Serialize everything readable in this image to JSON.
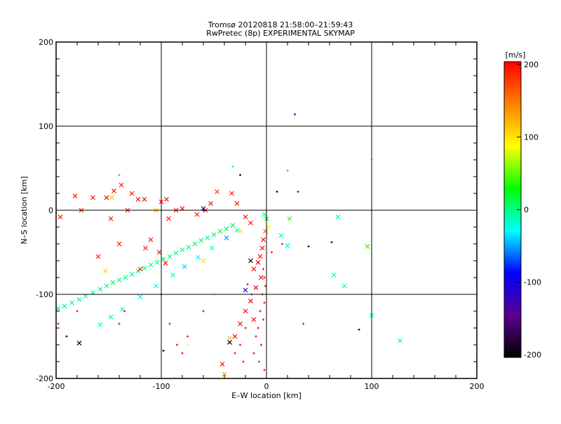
{
  "chart_data": {
    "type": "scatter",
    "title": "Tromsø 20120818 21:58:00–21:59:43",
    "subtitle": "RwPretec (8p) EXPERIMENTAL SKYMAP",
    "xlabel": "E–W location [km]",
    "ylabel": "N–S location [km]",
    "xlim": [
      -200,
      200
    ],
    "ylim": [
      -200,
      200
    ],
    "xticks": [
      "-200",
      "-100",
      "0",
      "100",
      "200"
    ],
    "yticks": [
      "-200",
      "-100",
      "0",
      "100",
      "200"
    ],
    "grid": true,
    "colorbar": {
      "label": "[m/s]",
      "range": [
        -200,
        200
      ],
      "ticks": [
        "200",
        "100",
        "0",
        "-100",
        "-200"
      ],
      "colors": [
        "#000000",
        "#5a0090",
        "#0000ff",
        "#00ffff",
        "#00ff00",
        "#ffff00",
        "#ff8000",
        "#ff0000"
      ]
    },
    "points_columns": [
      "x_km",
      "y_km",
      "velocity_ms",
      "marker"
    ],
    "points": [
      [
        -198,
        -117,
        0,
        "x"
      ],
      [
        -192,
        -114,
        -5,
        "x"
      ],
      [
        -185,
        -110,
        5,
        "x"
      ],
      [
        -178,
        -106,
        0,
        "x"
      ],
      [
        -172,
        -102,
        -10,
        "x"
      ],
      [
        -165,
        -98,
        0,
        "x"
      ],
      [
        -158,
        -94,
        -5,
        "x"
      ],
      [
        -152,
        -90,
        0,
        "x"
      ],
      [
        -146,
        -86,
        5,
        "x"
      ],
      [
        -140,
        -83,
        -5,
        "x"
      ],
      [
        -134,
        -80,
        0,
        "x"
      ],
      [
        -128,
        -76,
        -10,
        "x"
      ],
      [
        -122,
        -72,
        0,
        "x"
      ],
      [
        -116,
        -69,
        5,
        "x"
      ],
      [
        -110,
        -65,
        0,
        "x"
      ],
      [
        -104,
        -62,
        -5,
        "x"
      ],
      [
        -98,
        -58,
        0,
        "x"
      ],
      [
        -92,
        -55,
        5,
        "x"
      ],
      [
        -86,
        -51,
        0,
        "x"
      ],
      [
        -80,
        -47,
        -5,
        "x"
      ],
      [
        -74,
        -44,
        0,
        "x"
      ],
      [
        -68,
        -40,
        5,
        "x"
      ],
      [
        -62,
        -36,
        0,
        "x"
      ],
      [
        -56,
        -33,
        -5,
        "x"
      ],
      [
        -50,
        -29,
        0,
        "x"
      ],
      [
        -44,
        -25,
        10,
        "x"
      ],
      [
        -38,
        -22,
        5,
        "x"
      ],
      [
        -32,
        -18,
        15,
        "x"
      ],
      [
        -158,
        -136,
        -20,
        "x"
      ],
      [
        -148,
        -127,
        -15,
        "x"
      ],
      [
        -137,
        -118,
        -20,
        "x"
      ],
      [
        -120,
        -103,
        -30,
        "x"
      ],
      [
        -105,
        -90,
        -25,
        "x"
      ],
      [
        -89,
        -77,
        -20,
        "x"
      ],
      [
        -78,
        -67,
        -40,
        "x"
      ],
      [
        -65,
        -56,
        -30,
        "x"
      ],
      [
        -52,
        -45,
        -25,
        "x"
      ],
      [
        -38,
        -33,
        -50,
        "x"
      ],
      [
        -28,
        -24,
        -30,
        "x"
      ],
      [
        -196,
        -8,
        190,
        "x"
      ],
      [
        -182,
        17,
        190,
        "x"
      ],
      [
        -176,
        0,
        190,
        "x"
      ],
      [
        -165,
        15,
        190,
        "x"
      ],
      [
        -152,
        15,
        200,
        "x"
      ],
      [
        -148,
        -10,
        190,
        "x"
      ],
      [
        -145,
        23,
        190,
        "x"
      ],
      [
        -138,
        30,
        190,
        "x"
      ],
      [
        -132,
        0,
        190,
        "x"
      ],
      [
        -128,
        20,
        190,
        "x"
      ],
      [
        -122,
        13,
        190,
        "x"
      ],
      [
        -116,
        13,
        190,
        "x"
      ],
      [
        -105,
        0,
        190,
        "x"
      ],
      [
        -100,
        10,
        190,
        "x"
      ],
      [
        -95,
        13,
        190,
        "x"
      ],
      [
        -93,
        -10,
        190,
        "x"
      ],
      [
        -86,
        0,
        190,
        "x"
      ],
      [
        -80,
        2,
        190,
        "x"
      ],
      [
        -66,
        -5,
        190,
        "x"
      ],
      [
        -58,
        0,
        190,
        "x"
      ],
      [
        -53,
        8,
        190,
        "x"
      ],
      [
        -47,
        22,
        170,
        "x"
      ],
      [
        -33,
        20,
        190,
        "x"
      ],
      [
        -28,
        8,
        190,
        "x"
      ],
      [
        -20,
        -8,
        190,
        "x"
      ],
      [
        -15,
        -15,
        190,
        "x"
      ],
      [
        -110,
        -35,
        190,
        "x"
      ],
      [
        -115,
        -45,
        190,
        "x"
      ],
      [
        -102,
        -50,
        190,
        "x"
      ],
      [
        -96,
        -63,
        190,
        "x"
      ],
      [
        -120,
        -70,
        190,
        "x"
      ],
      [
        -160,
        -55,
        190,
        "x"
      ],
      [
        -140,
        -40,
        190,
        "x"
      ],
      [
        -147,
        15,
        110,
        "x"
      ],
      [
        -153,
        -72,
        100,
        "x"
      ],
      [
        -105,
        0,
        100,
        "x"
      ],
      [
        -25,
        -25,
        100,
        "x"
      ],
      [
        -60,
        -60,
        100,
        "x"
      ],
      [
        -60,
        2,
        -100,
        "x"
      ],
      [
        -20,
        -95,
        -100,
        "x"
      ],
      [
        -15,
        -60,
        -200,
        "x"
      ],
      [
        -178,
        -158,
        -200,
        "x"
      ],
      [
        -35,
        -157,
        -200,
        "x"
      ],
      [
        -2,
        -5,
        0,
        "x"
      ],
      [
        0,
        -10,
        20,
        "x"
      ],
      [
        2,
        -20,
        80,
        "x"
      ],
      [
        -1,
        -25,
        150,
        "x"
      ],
      [
        -3,
        -35,
        200,
        "x"
      ],
      [
        -4,
        -45,
        200,
        "x"
      ],
      [
        -6,
        -55,
        200,
        "x"
      ],
      [
        -8,
        -62,
        200,
        "x"
      ],
      [
        -12,
        -70,
        200,
        "x"
      ],
      [
        -5,
        -80,
        200,
        "x"
      ],
      [
        -10,
        -92,
        200,
        "x"
      ],
      [
        -15,
        -108,
        200,
        "x"
      ],
      [
        -20,
        -120,
        200,
        "x"
      ],
      [
        -25,
        -135,
        200,
        "x"
      ],
      [
        -30,
        -150,
        200,
        "x"
      ],
      [
        -12,
        -130,
        200,
        "x"
      ],
      [
        -42,
        -183,
        190,
        "x"
      ],
      [
        -35,
        -152,
        110,
        "x"
      ],
      [
        -40,
        -195,
        130,
        "x"
      ],
      [
        -3,
        -70,
        200,
        "+"
      ],
      [
        -2,
        -80,
        200,
        "+"
      ],
      [
        -1,
        -90,
        200,
        "+"
      ],
      [
        -4,
        -100,
        200,
        "+"
      ],
      [
        -2,
        -110,
        200,
        "+"
      ],
      [
        -6,
        -120,
        200,
        "+"
      ],
      [
        -3,
        -130,
        200,
        "+"
      ],
      [
        -8,
        -140,
        200,
        "+"
      ],
      [
        -10,
        -150,
        200,
        "+"
      ],
      [
        -5,
        -160,
        200,
        "+"
      ],
      [
        -12,
        -170,
        200,
        "+"
      ],
      [
        -7,
        -180,
        200,
        "+"
      ],
      [
        -2,
        -190,
        200,
        "+"
      ],
      [
        -14,
        -100,
        200,
        "+"
      ],
      [
        -18,
        -88,
        200,
        "+"
      ],
      [
        -20,
        -140,
        200,
        "+"
      ],
      [
        -25,
        -160,
        200,
        "+"
      ],
      [
        -30,
        -170,
        200,
        "+"
      ],
      [
        -22,
        -180,
        200,
        "+"
      ],
      [
        -85,
        -160,
        200,
        "+"
      ],
      [
        -80,
        -170,
        200,
        "+"
      ],
      [
        -100,
        -100,
        200,
        "+"
      ],
      [
        -135,
        -120,
        200,
        "+"
      ],
      [
        -140,
        -135,
        200,
        "+"
      ],
      [
        -180,
        -120,
        200,
        "+"
      ],
      [
        -198,
        -135,
        200,
        "+"
      ],
      [
        35,
        -135,
        200,
        "+"
      ],
      [
        15,
        -40,
        200,
        "+"
      ],
      [
        5,
        -50,
        200,
        "+"
      ],
      [
        -92,
        -135,
        200,
        "+"
      ],
      [
        -75,
        -150,
        200,
        "+"
      ],
      [
        -60,
        -120,
        200,
        "+"
      ],
      [
        27,
        114,
        -120,
        "+"
      ],
      [
        100,
        60,
        -20,
        "+"
      ],
      [
        -32,
        52,
        10,
        "+"
      ],
      [
        -25,
        42,
        -200,
        "+"
      ],
      [
        -140,
        42,
        150,
        "+"
      ],
      [
        20,
        47,
        150,
        "+"
      ],
      [
        30,
        22,
        -150,
        "+"
      ],
      [
        10,
        22,
        -200,
        "+"
      ],
      [
        -60,
        0,
        -120,
        "+"
      ],
      [
        -98,
        -167,
        -200,
        "+"
      ],
      [
        88,
        -142,
        -200,
        "+"
      ],
      [
        40,
        -43,
        -200,
        "+"
      ],
      [
        62,
        -38,
        -200,
        "+"
      ],
      [
        -50,
        -100,
        100,
        "+"
      ],
      [
        -75,
        -160,
        80,
        "+"
      ],
      [
        22,
        -10,
        40,
        "x"
      ],
      [
        20,
        -42,
        -30,
        "x"
      ],
      [
        68,
        -8,
        -20,
        "x"
      ],
      [
        64,
        -77,
        -20,
        "x"
      ],
      [
        74,
        -90,
        -10,
        "x"
      ],
      [
        96,
        -43,
        40,
        "x"
      ],
      [
        100,
        -125,
        -20,
        "x"
      ],
      [
        127,
        -155,
        -10,
        "x"
      ],
      [
        14,
        -30,
        -10,
        "x"
      ],
      [
        -190,
        -150,
        -200,
        "+"
      ]
    ]
  }
}
